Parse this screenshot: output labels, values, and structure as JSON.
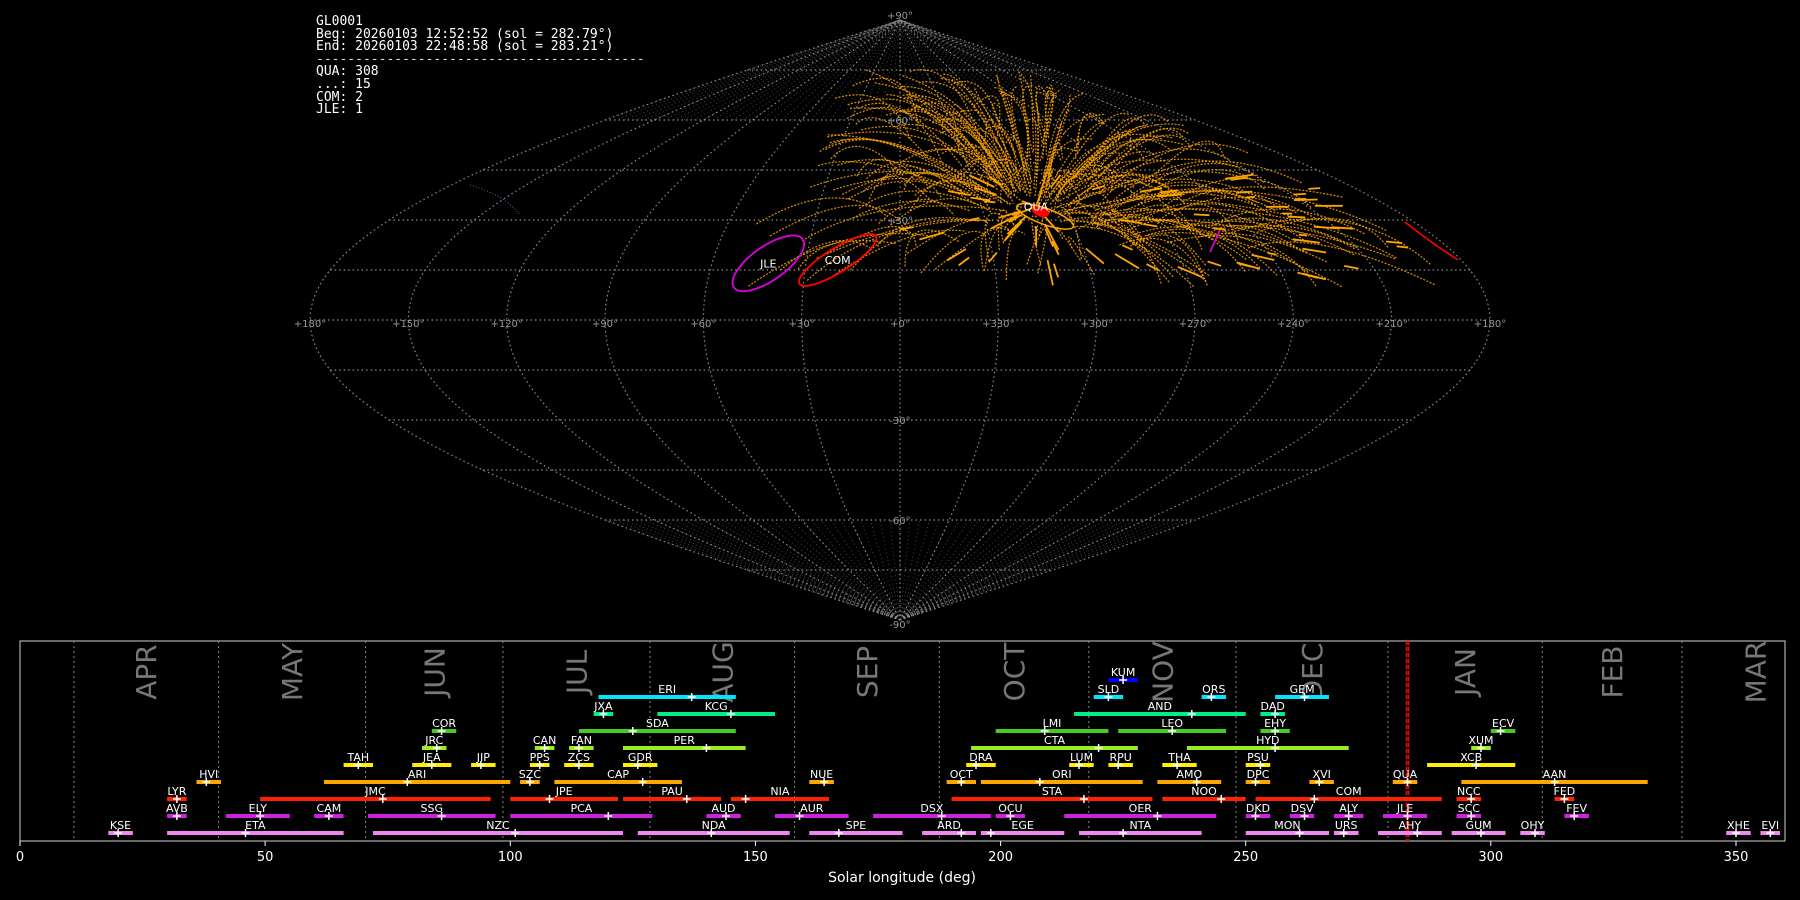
{
  "info": {
    "station": "GL0001",
    "begin": "Beg: 20260103 12:52:52 (sol = 282.79°)",
    "end": "End: 20260103 22:48:58 (sol = 283.21°)",
    "separator": "------------------------------------------",
    "counts": [
      "QUA: 308",
      "...: 15",
      "COM: 2",
      "JLE: 1"
    ]
  },
  "colors": {
    "background": "#000000",
    "grid": "#8c8c8c",
    "sporadic_trail": "#ffa500",
    "highlight": "#ff0000",
    "jle": "#dd00dd",
    "now_line": "#ff0000"
  },
  "skymap": {
    "projection": "sinusoidal",
    "lon_ticks": [
      "+180°",
      "+150°",
      "+120°",
      "+90°",
      "+60°",
      "+30°",
      "+0°",
      "+330°",
      "+300°",
      "+270°",
      "+240°",
      "+210°",
      "+180°"
    ],
    "lat_ticks": [
      "+90°",
      "+60°",
      "+30°",
      "-30°",
      "-60°",
      "-90°"
    ],
    "radiant_labels": [
      {
        "name": "QUA",
        "lon": 230,
        "lat": 34
      },
      {
        "name": "COM",
        "lon": 160,
        "lat": 18
      },
      {
        "name": "JLE",
        "lon": 138,
        "lat": 17
      }
    ]
  },
  "chart_data": {
    "type": "timeline",
    "xlabel": "Solar longitude (deg)",
    "xlim": [
      0,
      360
    ],
    "x_ticks": [
      0,
      50,
      100,
      150,
      200,
      250,
      300,
      350
    ],
    "months": [
      {
        "name": "APR",
        "start": 11
      },
      {
        "name": "MAY",
        "start": 40.5
      },
      {
        "name": "JUN",
        "start": 70.5
      },
      {
        "name": "JUL",
        "start": 98.5
      },
      {
        "name": "AUG",
        "start": 128.5
      },
      {
        "name": "SEP",
        "start": 158
      },
      {
        "name": "OCT",
        "start": 187.5
      },
      {
        "name": "NOV",
        "start": 218
      },
      {
        "name": "DEC",
        "start": 248
      },
      {
        "name": "JAN",
        "start": 279
      },
      {
        "name": "FEB",
        "start": 310.5
      },
      {
        "name": "MAR",
        "start": 339
      }
    ],
    "current_sol": [
      282.79,
      283.21
    ],
    "showers": [
      {
        "code": "KUM",
        "start": 222,
        "end": 228,
        "peak": 225,
        "row": 11,
        "color": "#0000ff"
      },
      {
        "code": "ERI",
        "start": 118,
        "end": 146,
        "peak": 137,
        "row": 10,
        "color": "#00e5ff"
      },
      {
        "code": "SLD",
        "start": 219,
        "end": 225,
        "peak": 222,
        "row": 10,
        "color": "#00e5ff"
      },
      {
        "code": "ORS",
        "start": 241,
        "end": 246,
        "peak": 243,
        "row": 10,
        "color": "#00e5ff"
      },
      {
        "code": "GEM",
        "start": 256,
        "end": 267,
        "peak": 262,
        "row": 10,
        "color": "#00e5ff"
      },
      {
        "code": "JXA",
        "start": 117,
        "end": 121,
        "peak": 119,
        "row": 9,
        "color": "#00ee88"
      },
      {
        "code": "KCG",
        "start": 130,
        "end": 154,
        "peak": 145,
        "row": 9,
        "color": "#00ee88"
      },
      {
        "code": "AND",
        "start": 215,
        "end": 250,
        "peak": 239,
        "row": 9,
        "color": "#00ee88"
      },
      {
        "code": "DAD",
        "start": 253,
        "end": 258,
        "peak": 256,
        "row": 9,
        "color": "#00ee88"
      },
      {
        "code": "COR",
        "start": 84,
        "end": 89,
        "peak": 86,
        "row": 8,
        "color": "#44cc22"
      },
      {
        "code": "SDA",
        "start": 114,
        "end": 146,
        "peak": 125,
        "row": 8,
        "color": "#44cc22"
      },
      {
        "code": "LMI",
        "start": 199,
        "end": 222,
        "peak": 209,
        "row": 8,
        "color": "#44cc22"
      },
      {
        "code": "LEO",
        "start": 224,
        "end": 246,
        "peak": 235,
        "row": 8,
        "color": "#44cc22"
      },
      {
        "code": "EHY",
        "start": 253,
        "end": 259,
        "peak": 256,
        "row": 8,
        "color": "#44cc22"
      },
      {
        "code": "ECV",
        "start": 300,
        "end": 305,
        "peak": 302,
        "row": 8,
        "color": "#44cc22"
      },
      {
        "code": "JRC",
        "start": 82,
        "end": 87,
        "peak": 85,
        "row": 7,
        "color": "#99ee22"
      },
      {
        "code": "CAN",
        "start": 105,
        "end": 109,
        "peak": 107,
        "row": 7,
        "color": "#99ee22"
      },
      {
        "code": "FAN",
        "start": 112,
        "end": 117,
        "peak": 114,
        "row": 7,
        "color": "#99ee22"
      },
      {
        "code": "PER",
        "start": 123,
        "end": 148,
        "peak": 140,
        "row": 7,
        "color": "#99ee22"
      },
      {
        "code": "CTA",
        "start": 194,
        "end": 228,
        "peak": 220,
        "row": 7,
        "color": "#99ee22"
      },
      {
        "code": "HYD",
        "start": 238,
        "end": 271,
        "peak": 256,
        "row": 7,
        "color": "#99ee22"
      },
      {
        "code": "XUM",
        "start": 296,
        "end": 300,
        "peak": 298,
        "row": 7,
        "color": "#99ee22"
      },
      {
        "code": "TAH",
        "start": 66,
        "end": 72,
        "peak": 69,
        "row": 6,
        "color": "#ffee00"
      },
      {
        "code": "JEA",
        "start": 80,
        "end": 88,
        "peak": 84,
        "row": 6,
        "color": "#ffee00"
      },
      {
        "code": "JIP",
        "start": 92,
        "end": 97,
        "peak": 94,
        "row": 6,
        "color": "#ffee00"
      },
      {
        "code": "PPS",
        "start": 104,
        "end": 108,
        "peak": 106,
        "row": 6,
        "color": "#ffee00"
      },
      {
        "code": "ZCS",
        "start": 111,
        "end": 117,
        "peak": 114,
        "row": 6,
        "color": "#ffee00"
      },
      {
        "code": "GDR",
        "start": 123,
        "end": 130,
        "peak": 126,
        "row": 6,
        "color": "#ffee00"
      },
      {
        "code": "DRA",
        "start": 193,
        "end": 199,
        "peak": 195,
        "row": 6,
        "color": "#ffee00"
      },
      {
        "code": "LUM",
        "start": 214,
        "end": 219,
        "peak": 216,
        "row": 6,
        "color": "#ffee00"
      },
      {
        "code": "RPU",
        "start": 222,
        "end": 227,
        "peak": 224,
        "row": 6,
        "color": "#ffee00"
      },
      {
        "code": "THA",
        "start": 233,
        "end": 240,
        "peak": 236,
        "row": 6,
        "color": "#ffee00"
      },
      {
        "code": "PSU",
        "start": 250,
        "end": 255,
        "peak": 253,
        "row": 6,
        "color": "#ffee00"
      },
      {
        "code": "XCB",
        "start": 287,
        "end": 305,
        "peak": 297,
        "row": 6,
        "color": "#ffee00"
      },
      {
        "code": "HVI",
        "start": 36,
        "end": 41,
        "peak": 38,
        "row": 5,
        "color": "#ffa500"
      },
      {
        "code": "ARI",
        "start": 62,
        "end": 100,
        "peak": 79,
        "row": 5,
        "color": "#ffa500"
      },
      {
        "code": "SZC",
        "start": 102,
        "end": 106,
        "peak": 104,
        "row": 5,
        "color": "#ffa500"
      },
      {
        "code": "CAP",
        "start": 109,
        "end": 135,
        "peak": 127,
        "row": 5,
        "color": "#ffa500"
      },
      {
        "code": "NUE",
        "start": 161,
        "end": 166,
        "peak": 164,
        "row": 5,
        "color": "#ffa500"
      },
      {
        "code": "OCT",
        "start": 189,
        "end": 195,
        "peak": 192,
        "row": 5,
        "color": "#ffa500"
      },
      {
        "code": "ORI",
        "start": 196,
        "end": 229,
        "peak": 208,
        "row": 5,
        "color": "#ffa500"
      },
      {
        "code": "AMO",
        "start": 232,
        "end": 245,
        "peak": 240,
        "row": 5,
        "color": "#ffa500"
      },
      {
        "code": "DPC",
        "start": 250,
        "end": 255,
        "peak": 252,
        "row": 5,
        "color": "#ffa500"
      },
      {
        "code": "XVI",
        "start": 263,
        "end": 268,
        "peak": 265,
        "row": 5,
        "color": "#ffa500"
      },
      {
        "code": "QUA",
        "start": 280,
        "end": 285,
        "peak": 283,
        "row": 5,
        "color": "#ffa500"
      },
      {
        "code": "AAN",
        "start": 294,
        "end": 332,
        "peak": 313,
        "row": 5,
        "color": "#ffa500"
      },
      {
        "code": "LYR",
        "start": 30,
        "end": 34,
        "peak": 32,
        "row": 4,
        "color": "#ff2200"
      },
      {
        "code": "JMC",
        "start": 49,
        "end": 96,
        "peak": 74,
        "row": 4,
        "color": "#ff2200"
      },
      {
        "code": "JPE",
        "start": 100,
        "end": 122,
        "peak": 108,
        "row": 4,
        "color": "#ff2200"
      },
      {
        "code": "PAU",
        "start": 123,
        "end": 143,
        "peak": 136,
        "row": 4,
        "color": "#ff2200"
      },
      {
        "code": "NIA",
        "start": 145,
        "end": 165,
        "peak": 148,
        "row": 4,
        "color": "#ff2200"
      },
      {
        "code": "STA",
        "start": 190,
        "end": 231,
        "peak": 217,
        "row": 4,
        "color": "#ff2200"
      },
      {
        "code": "NOO",
        "start": 233,
        "end": 250,
        "peak": 245,
        "row": 4,
        "color": "#ff2200"
      },
      {
        "code": "COM",
        "start": 252,
        "end": 290,
        "peak": 264,
        "row": 4,
        "color": "#ff2200"
      },
      {
        "code": "NCC",
        "start": 293,
        "end": 298,
        "peak": 296,
        "row": 4,
        "color": "#ff2200"
      },
      {
        "code": "FED",
        "start": 313,
        "end": 317,
        "peak": 315,
        "row": 4,
        "color": "#ff2200"
      },
      {
        "code": "AVB",
        "start": 30,
        "end": 34,
        "peak": 32,
        "row": 3,
        "color": "#cc22dd"
      },
      {
        "code": "ELY",
        "start": 42,
        "end": 55,
        "peak": 49,
        "row": 3,
        "color": "#cc22dd"
      },
      {
        "code": "CAM",
        "start": 60,
        "end": 66,
        "peak": 63,
        "row": 3,
        "color": "#cc22dd"
      },
      {
        "code": "SSG",
        "start": 71,
        "end": 97,
        "peak": 86,
        "row": 3,
        "color": "#cc22dd"
      },
      {
        "code": "PCA",
        "start": 100,
        "end": 129,
        "peak": 120,
        "row": 3,
        "color": "#cc22dd"
      },
      {
        "code": "AUD",
        "start": 140,
        "end": 147,
        "peak": 144,
        "row": 3,
        "color": "#cc22dd"
      },
      {
        "code": "AUR",
        "start": 154,
        "end": 169,
        "peak": 159,
        "row": 3,
        "color": "#cc22dd"
      },
      {
        "code": "DSX",
        "start": 174,
        "end": 198,
        "peak": 188,
        "row": 3,
        "color": "#cc22dd"
      },
      {
        "code": "OCU",
        "start": 199,
        "end": 205,
        "peak": 202,
        "row": 3,
        "color": "#cc22dd"
      },
      {
        "code": "OER",
        "start": 213,
        "end": 244,
        "peak": 232,
        "row": 3,
        "color": "#cc22dd"
      },
      {
        "code": "DKD",
        "start": 250,
        "end": 255,
        "peak": 252,
        "row": 3,
        "color": "#cc22dd"
      },
      {
        "code": "DSV",
        "start": 259,
        "end": 264,
        "peak": 262,
        "row": 3,
        "color": "#cc22dd"
      },
      {
        "code": "ALY",
        "start": 268,
        "end": 274,
        "peak": 271,
        "row": 3,
        "color": "#cc22dd"
      },
      {
        "code": "JLE",
        "start": 278,
        "end": 287,
        "peak": 283,
        "row": 3,
        "color": "#cc22dd"
      },
      {
        "code": "SCC",
        "start": 293,
        "end": 298,
        "peak": 296,
        "row": 3,
        "color": "#cc22dd"
      },
      {
        "code": "FEV",
        "start": 315,
        "end": 320,
        "peak": 317,
        "row": 3,
        "color": "#cc22dd"
      },
      {
        "code": "KSE",
        "start": 18,
        "end": 23,
        "peak": 20,
        "row": 2,
        "color": "#ee88ee"
      },
      {
        "code": "ETA",
        "start": 30,
        "end": 66,
        "peak": 46,
        "row": 2,
        "color": "#ee88ee"
      },
      {
        "code": "NZC",
        "start": 72,
        "end": 123,
        "peak": 101,
        "row": 2,
        "color": "#ee88ee"
      },
      {
        "code": "NDA",
        "start": 126,
        "end": 157,
        "peak": 141,
        "row": 2,
        "color": "#ee88ee"
      },
      {
        "code": "SPE",
        "start": 161,
        "end": 180,
        "peak": 167,
        "row": 2,
        "color": "#ee88ee"
      },
      {
        "code": "ARD",
        "start": 184,
        "end": 195,
        "peak": 192,
        "row": 2,
        "color": "#ee88ee"
      },
      {
        "code": "EGE",
        "start": 196,
        "end": 213,
        "peak": 198,
        "row": 2,
        "color": "#ee88ee"
      },
      {
        "code": "NTA",
        "start": 216,
        "end": 241,
        "peak": 225,
        "row": 2,
        "color": "#ee88ee"
      },
      {
        "code": "MON",
        "start": 250,
        "end": 267,
        "peak": 261,
        "row": 2,
        "color": "#ee88ee"
      },
      {
        "code": "URS",
        "start": 268,
        "end": 273,
        "peak": 270,
        "row": 2,
        "color": "#ee88ee"
      },
      {
        "code": "AHY",
        "start": 277,
        "end": 290,
        "peak": 285,
        "row": 2,
        "color": "#ee88ee"
      },
      {
        "code": "GUM",
        "start": 292,
        "end": 303,
        "peak": 298,
        "row": 2,
        "color": "#ee88ee"
      },
      {
        "code": "OHY",
        "start": 306,
        "end": 311,
        "peak": 309,
        "row": 2,
        "color": "#ee88ee"
      },
      {
        "code": "XHE",
        "start": 348,
        "end": 353,
        "peak": 350,
        "row": 2,
        "color": "#ee88ee"
      },
      {
        "code": "EVI",
        "start": 355,
        "end": 359,
        "peak": 357,
        "row": 2,
        "color": "#ee88ee"
      }
    ]
  }
}
